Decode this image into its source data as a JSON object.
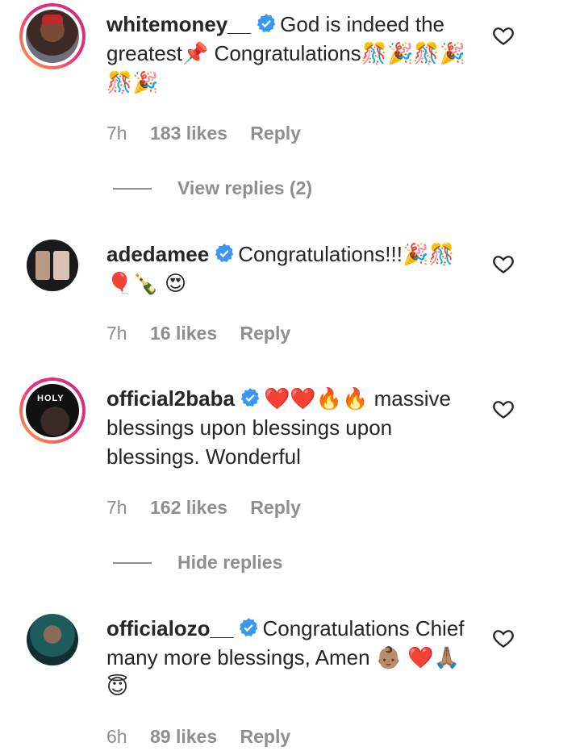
{
  "comments": [
    {
      "username": "whitemoney__",
      "verified": true,
      "text": "God is indeed the greatest📌 Congratulations🎊🎉🎊🎉🎊🎉",
      "time": "7h",
      "likes": "183 likes",
      "reply": "Reply",
      "replies_toggle": "View replies (2)"
    },
    {
      "username": "adedamee",
      "verified": true,
      "text": "Congratulations!!!🎉🎊🎈🍾 😍",
      "time": "7h",
      "likes": "16 likes",
      "reply": "Reply"
    },
    {
      "username": "official2baba",
      "verified": true,
      "text": "❤️❤️🔥🔥 massive blessings upon blessings upon blessings. Wonderful",
      "time": "7h",
      "likes": "162 likes",
      "reply": "Reply",
      "replies_toggle": "Hide replies"
    },
    {
      "username": "officialozo__",
      "verified": true,
      "text": "Congratulations Chief many more blessings, Amen 👶🏽 ❤️🙏🏽😇",
      "time": "6h",
      "likes": "89 likes",
      "reply": "Reply"
    }
  ],
  "colors": {
    "verified": "#3897f0",
    "meta": "#8e8e8e",
    "text": "#262626"
  },
  "icons": {
    "like": "heart-outline-icon",
    "verified": "verified-badge-icon"
  }
}
